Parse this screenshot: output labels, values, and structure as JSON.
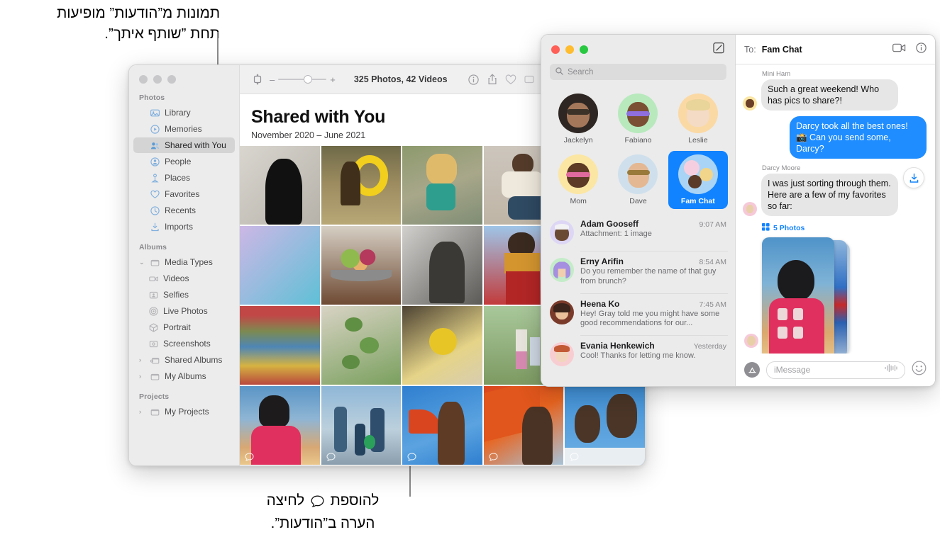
{
  "callouts": {
    "top": {
      "line1": "תמונות מ”הודעות” מופיעות",
      "line2": "תחת ”שותף איתך”."
    },
    "bottom": {
      "before": "לחיצה",
      "after": "להוספת",
      "line2": "הערה ב”הודעות”."
    }
  },
  "photos_app": {
    "toolbar": {
      "rotate_icon": "rotate-icon",
      "zoom_out": "–",
      "zoom_in": "+",
      "count": "325 Photos, 42 Videos",
      "info_icon": "info-icon",
      "share_icon": "share-icon",
      "favorite_icon": "heart-icon",
      "more_icon": "more-icon"
    },
    "header": {
      "title": "Shared with You",
      "subtitle": "November 2020 – June 2021"
    },
    "sidebar": {
      "sections": [
        {
          "label": "Photos",
          "items": [
            {
              "label": "Library",
              "icon": "library-icon",
              "selected": false,
              "indent": 0,
              "caret": ""
            },
            {
              "label": "Memories",
              "icon": "memories-icon",
              "selected": false,
              "indent": 0,
              "caret": ""
            },
            {
              "label": "Shared with You",
              "icon": "shared-with-you-icon",
              "selected": true,
              "indent": 0,
              "caret": ""
            },
            {
              "label": "People",
              "icon": "people-icon",
              "selected": false,
              "indent": 0,
              "caret": ""
            },
            {
              "label": "Places",
              "icon": "places-icon",
              "selected": false,
              "indent": 0,
              "caret": ""
            },
            {
              "label": "Favorites",
              "icon": "heart-icon",
              "selected": false,
              "indent": 0,
              "caret": ""
            },
            {
              "label": "Recents",
              "icon": "clock-icon",
              "selected": false,
              "indent": 0,
              "caret": ""
            },
            {
              "label": "Imports",
              "icon": "import-icon",
              "selected": false,
              "indent": 0,
              "caret": ""
            }
          ]
        },
        {
          "label": "Albums",
          "items": [
            {
              "label": "Media Types",
              "icon": "folder-icon",
              "selected": false,
              "indent": 0,
              "caret": "v"
            },
            {
              "label": "Videos",
              "icon": "video-icon",
              "selected": false,
              "indent": 1,
              "caret": ""
            },
            {
              "label": "Selfies",
              "icon": "selfie-icon",
              "selected": false,
              "indent": 1,
              "caret": ""
            },
            {
              "label": "Live Photos",
              "icon": "live-photo-icon",
              "selected": false,
              "indent": 1,
              "caret": ""
            },
            {
              "label": "Portrait",
              "icon": "portrait-icon",
              "selected": false,
              "indent": 1,
              "caret": ""
            },
            {
              "label": "Screenshots",
              "icon": "screenshot-icon",
              "selected": false,
              "indent": 1,
              "caret": ""
            },
            {
              "label": "Shared Albums",
              "icon": "shared-folder-icon",
              "selected": false,
              "indent": 0,
              "caret": ">"
            },
            {
              "label": "My Albums",
              "icon": "folder-icon",
              "selected": false,
              "indent": 0,
              "caret": ">"
            }
          ]
        },
        {
          "label": "Projects",
          "items": [
            {
              "label": "My Projects",
              "icon": "folder-icon",
              "selected": false,
              "indent": 0,
              "caret": ">"
            }
          ]
        }
      ]
    },
    "grid": [
      {
        "name": "silhouette-bw",
        "comment": false
      },
      {
        "name": "boy-yellow-float",
        "comment": false
      },
      {
        "name": "child-splashing",
        "comment": false
      },
      {
        "name": "man-sitting",
        "comment": false
      },
      {
        "name": "hidden-1",
        "comment": false
      },
      {
        "name": "blue-floral-fabric",
        "comment": false
      },
      {
        "name": "fruit-bowl",
        "comment": false
      },
      {
        "name": "portrait-bw-porch",
        "comment": false
      },
      {
        "name": "woman-red-pants",
        "comment": false
      },
      {
        "name": "hidden-2",
        "comment": false
      },
      {
        "name": "colored-pipes",
        "comment": false
      },
      {
        "name": "green-leaves",
        "comment": false
      },
      {
        "name": "yellow-bowl",
        "comment": false
      },
      {
        "name": "family-field",
        "comment": false
      },
      {
        "name": "hidden-3",
        "comment": false
      },
      {
        "name": "woman-pink-sunset",
        "comment": true
      },
      {
        "name": "family-beach",
        "comment": true
      },
      {
        "name": "boy-orange-umbrella",
        "comment": true
      },
      {
        "name": "man-orange-sail",
        "comment": true
      },
      {
        "name": "boy-and-man-blue",
        "comment": true
      }
    ]
  },
  "messages_app": {
    "search": {
      "placeholder": "Search",
      "icon": "search-icon"
    },
    "compose_icon": "compose-icon",
    "pinned": [
      {
        "name": "Jackelyn",
        "avatar": "photo-woman-sunglasses",
        "selected": false
      },
      {
        "name": "Fabiano",
        "avatar": "memoji-green",
        "selected": false
      },
      {
        "name": "Leslie",
        "avatar": "memoji-orange",
        "selected": false
      },
      {
        "name": "Mom",
        "avatar": "memoji-yellow",
        "selected": false
      },
      {
        "name": "Dave",
        "avatar": "photo-man-sunglasses",
        "selected": false
      },
      {
        "name": "Fam Chat",
        "avatar": "group-avatar",
        "selected": true
      }
    ],
    "conversations": [
      {
        "name": "Adam Gooseff",
        "time": "9:07 AM",
        "preview": "Attachment: 1 image",
        "avatar": "memoji-lavender"
      },
      {
        "name": "Erny Arifin",
        "time": "8:54 AM",
        "preview": "Do you remember the name of that guy from brunch?",
        "avatar": "memoji-mint"
      },
      {
        "name": "Heena Ko",
        "time": "7:45 AM",
        "preview": "Hey! Gray told me you might have some good recommendations for our...",
        "avatar": "photo-woman-bob"
      },
      {
        "name": "Evania Henkewich",
        "time": "Yesterday",
        "preview": "Cool! Thanks for letting me know.",
        "avatar": "memoji-pink"
      }
    ],
    "thread": {
      "to_label": "To:",
      "to_name": "Fam Chat",
      "facetime_icon": "facetime-video-icon",
      "details_icon": "info-icon",
      "messages": [
        {
          "sender": "Mini Ham",
          "text": "Such a great weekend! Who has pics to share?!",
          "outgoing": false,
          "avatar": "memoji-yellow-small"
        },
        {
          "sender": "",
          "text": "Darcy took all the best ones! 📸 Can you send some, Darcy?",
          "outgoing": true,
          "avatar": ""
        },
        {
          "sender": "Darcy Moore",
          "text": "I was just sorting through them. Here are a few of my favorites so far:",
          "outgoing": false,
          "avatar": "memoji-pink-small"
        }
      ],
      "attachment": {
        "label": "5 Photos",
        "grid_icon": "grid-icon",
        "save_icon": "save-to-photos-icon"
      },
      "composer": {
        "apps_icon": "app-store-icon",
        "placeholder": "iMessage",
        "audio_icon": "audio-waveform-icon",
        "emoji_icon": "emoji-icon"
      }
    }
  },
  "colors": {
    "accent_blue": "#1283ff",
    "bubble_blue": "#1f8dff",
    "bubble_gray": "#e6e6e6",
    "sidebar_gray": "#ececec"
  }
}
